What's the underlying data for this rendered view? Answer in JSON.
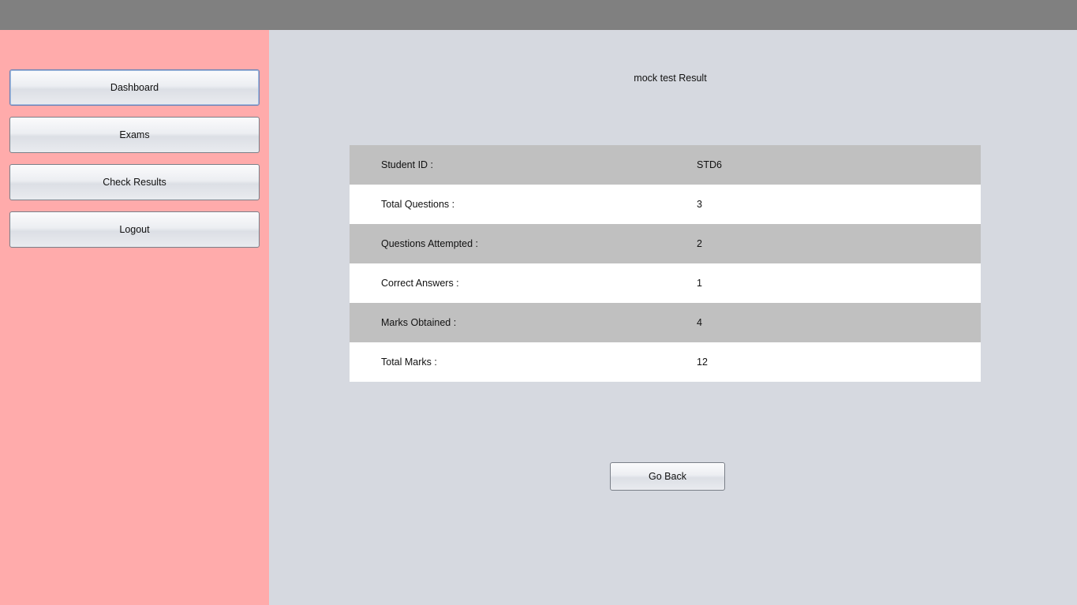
{
  "sidebar": {
    "items": [
      {
        "label": "Dashboard"
      },
      {
        "label": "Exams"
      },
      {
        "label": "Check Results"
      },
      {
        "label": "Logout"
      }
    ]
  },
  "main": {
    "title": "mock test Result",
    "rows": [
      {
        "label": "Student ID :",
        "value": "STD6"
      },
      {
        "label": "Total Questions :",
        "value": "3"
      },
      {
        "label": "Questions Attempted :",
        "value": "2"
      },
      {
        "label": "Correct Answers :",
        "value": "1"
      },
      {
        "label": "Marks Obtained :",
        "value": "4"
      },
      {
        "label": "Total Marks :",
        "value": "12"
      }
    ],
    "go_back_label": "Go Back"
  },
  "colors": {
    "topbar": "#808080",
    "sidebar": "#ffabab",
    "main_background": "#d6d9e0",
    "row_shaded": "#c0c0c0",
    "row_white": "#ffffff"
  }
}
